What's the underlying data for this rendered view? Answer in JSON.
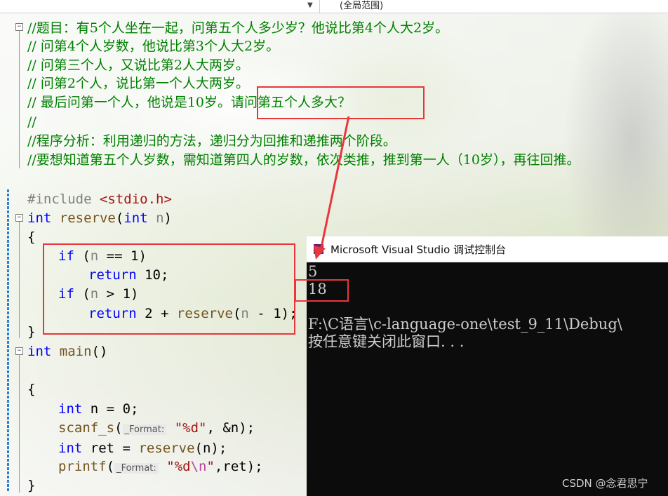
{
  "toolbar": {
    "scope_label": "(全局范围)"
  },
  "editor": {
    "comment_lines": [
      "//题目：有5个人坐在一起，问第五个人多少岁？他说比第4个人大2岁。",
      "// 问第4个人岁数，他说比第3个人大2岁。",
      "// 问第三个人，又说比第2人大两岁。",
      "// 问第2个人，说比第一个人大两岁。",
      "// 最后问第一个人，他说是10岁。请问第五个人多大？",
      "//",
      "//程序分析：利用递归的方法，递归分为回推和递推两个阶段。",
      "//要想知道第五个人岁数，需知道第四人的岁数，依次类推，推到第一人（10岁），再往回推。"
    ],
    "include_directive": "#include",
    "include_file": "<stdio.h>",
    "kw_int": "int",
    "kw_if": "if",
    "kw_return": "return",
    "fn_reserve": "reserve",
    "fn_main": "main",
    "fn_scanf": "scanf_s",
    "fn_printf": "printf",
    "param_n": "n",
    "var_ret": "ret",
    "hint_format": "_Format:",
    "str_scanf": "\"%d\"",
    "str_printf_start": "\"%d",
    "str_printf_esc": "\\n",
    "str_printf_end": "\"",
    "lit_1": "1",
    "lit_0": "0",
    "lit_10": "10",
    "lit_2": "2",
    "reserve_params": "(int n)"
  },
  "console": {
    "title": "Microsoft Visual Studio 调试控制台",
    "lines": [
      "5",
      "18",
      "",
      "F:\\C语言\\c-language-one\\test_9_11\\Debug\\",
      "按任意键关闭此窗口. . ."
    ]
  },
  "watermark": "CSDN @念君思宁",
  "colors": {
    "keyword": "#0000ff",
    "comment": "#008000",
    "string": "#a31515",
    "annotation_red": "#e8363c",
    "console_bg": "#0c0c0c"
  }
}
